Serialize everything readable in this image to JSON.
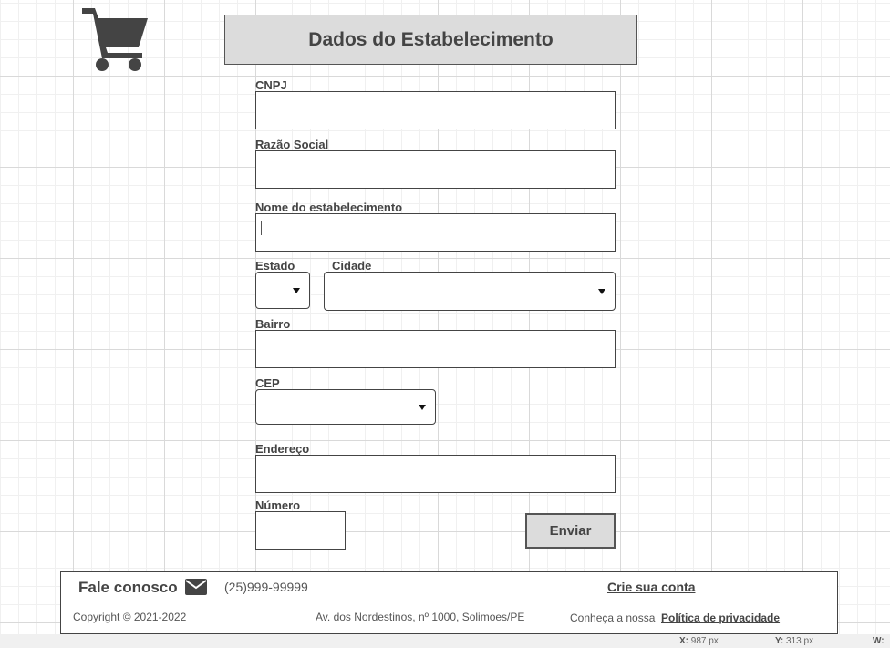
{
  "header": {
    "title": "Dados do Estabelecimento",
    "logo_icon": "shopping-cart-icon"
  },
  "form": {
    "cnpj": {
      "label": "CNPJ",
      "value": ""
    },
    "razao_social": {
      "label": "Razão Social",
      "value": ""
    },
    "nome_estabelecimento": {
      "label": "Nome do estabelecimento",
      "value": ""
    },
    "estado": {
      "label": "Estado",
      "value": ""
    },
    "cidade": {
      "label": "Cidade",
      "value": ""
    },
    "bairro": {
      "label": "Bairro",
      "value": ""
    },
    "cep": {
      "label": "CEP",
      "value": ""
    },
    "endereco": {
      "label": "Endereço",
      "value": ""
    },
    "numero": {
      "label": "Número",
      "value": ""
    },
    "submit_label": "Enviar"
  },
  "footer": {
    "contact_title": "Fale conosco",
    "contact_icon": "mail-icon",
    "phone": "(25)999-99999",
    "create_account": "Crie sua conta",
    "copyright": "Copyright © 2021-2022",
    "address": "Av. dos Nordestinos, nº 1000, Solimoes/PE",
    "policy_prefix": "Conheça a nossa",
    "policy_link": "Política de privacidade"
  },
  "statusbar": {
    "x_label": "X:",
    "x_value": "987 px",
    "y_label": "Y:",
    "y_value": "313 px",
    "w_label": "W:"
  },
  "colors": {
    "title_bg": "#dcdcdc",
    "border": "#444444",
    "text": "#444444",
    "grid": "#d9d9d9"
  }
}
